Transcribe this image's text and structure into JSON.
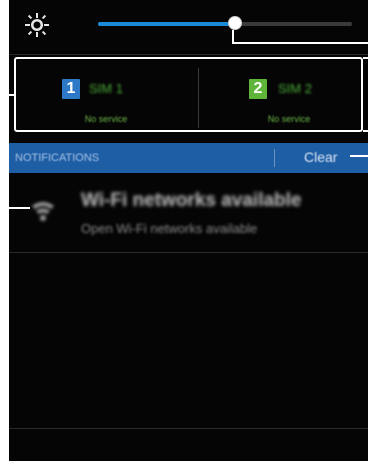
{
  "brightness": {
    "level": 0.54,
    "accent_color": "#1b8ad6"
  },
  "sims": [
    {
      "badge": "1",
      "name": "SIM 1",
      "status": "No service",
      "badge_color": "#2e78c8"
    },
    {
      "badge": "2",
      "name": "SIM 2",
      "status": "No service",
      "badge_color": "#5fb53a"
    }
  ],
  "notifications": {
    "header": "NOTIFICATIONS",
    "clear_label": "Clear",
    "bar_color": "#1e5ea5",
    "items": [
      {
        "icon": "wifi-icon",
        "title": "Wi-Fi networks available",
        "subtitle": "Open Wi-Fi networks available"
      }
    ]
  }
}
